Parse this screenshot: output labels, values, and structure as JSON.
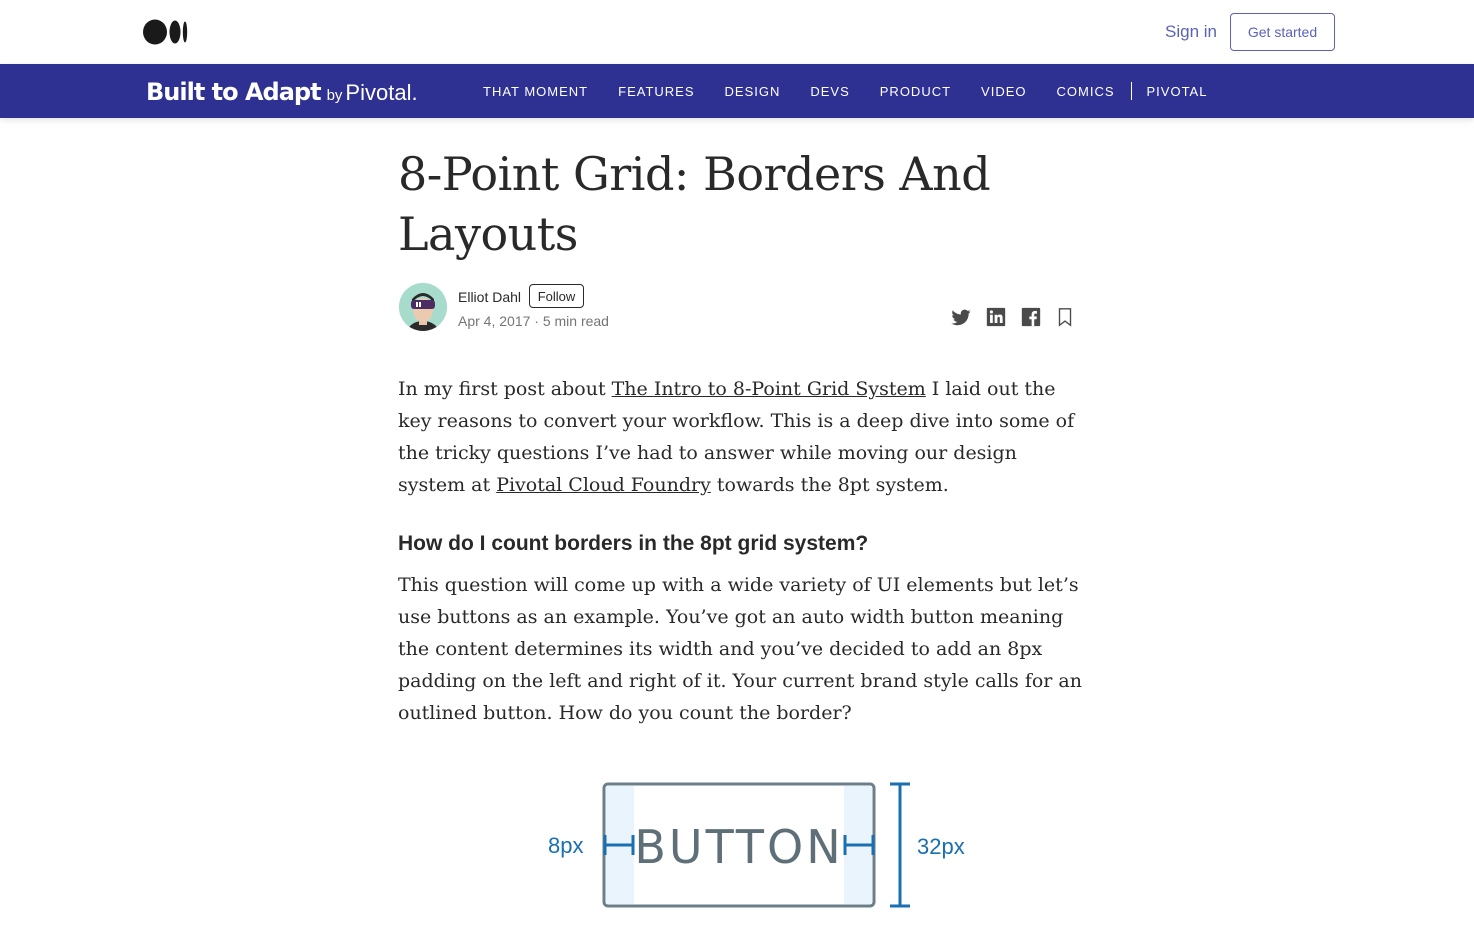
{
  "topbar": {
    "sign_in": "Sign in",
    "get_started": "Get started"
  },
  "publication": {
    "name": "Built to Adapt",
    "by": "by",
    "partner": "Pivotal.",
    "nav": [
      "THAT MOMENT",
      "FEATURES",
      "DESIGN",
      "DEVS",
      "PRODUCT",
      "VIDEO",
      "COMICS",
      "PIVOTAL"
    ],
    "background_color": "#2e3192"
  },
  "article": {
    "title_line1": "8-Point Grid: Borders And",
    "title_line2": "Layouts",
    "author": "Elliot Dahl",
    "follow_label": "Follow",
    "meta": "Apr 4, 2017 · 5 min read",
    "share_icons": [
      "twitter-icon",
      "linkedin-icon",
      "facebook-icon",
      "bookmark-icon"
    ],
    "p1": {
      "t1": "In my first post about ",
      "link1": "The Intro to 8-Point Grid System",
      "t2": " I laid out the key reasons to convert your workflow. This is a deep dive into some of the tricky questions I’ve had to answer while moving our design system at ",
      "link2": "Pivotal Cloud Foundry",
      "t3": " towards the 8pt system."
    },
    "subheading": "How do I count borders in the 8pt grid system?",
    "p2": "This question will come up with a wide variety of UI elements but let’s use buttons as an example. You’ve got an auto width button meaning the content determines its width and you’ve decided to add an 8px padding on the left and right of it. Your current brand style calls for an outlined button. How do you count the border?",
    "figure": {
      "padding_label": "8px",
      "button_text": "BUTTON",
      "height_label": "32px",
      "accent_color": "#1a6fb0"
    }
  }
}
